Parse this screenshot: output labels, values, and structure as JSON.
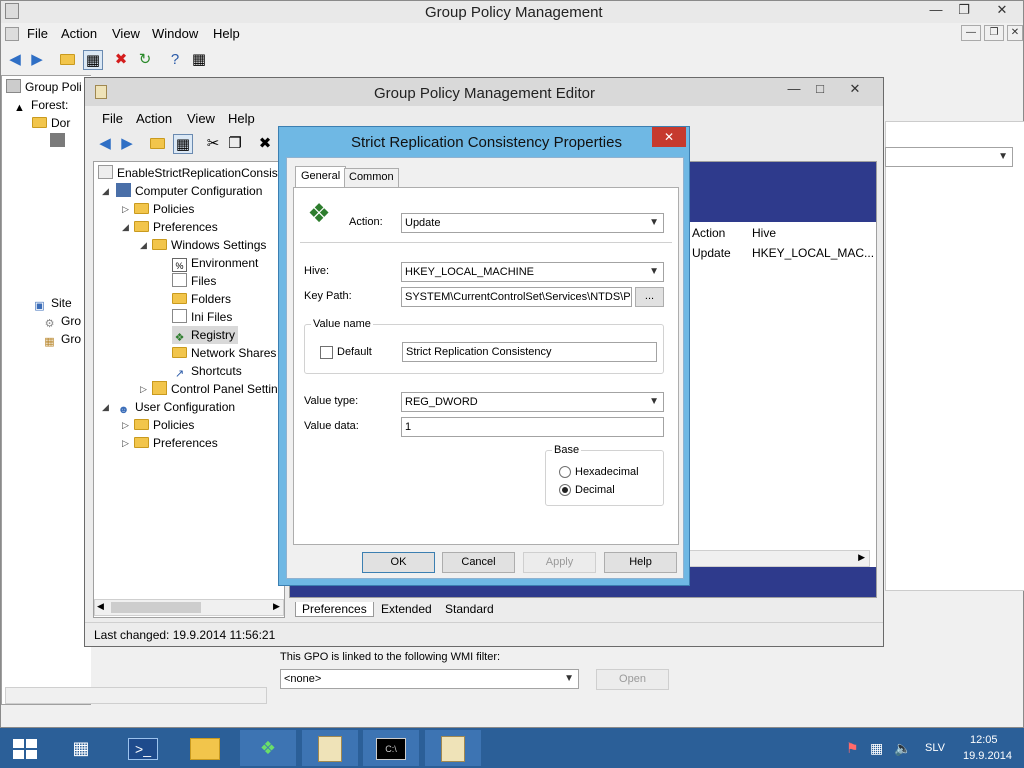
{
  "main_window": {
    "title": "Group Policy Management",
    "menu": [
      "File",
      "Action",
      "View",
      "Window",
      "Help"
    ],
    "tree": [
      "Group Poli",
      "Forest:",
      "Dor",
      "Site",
      "Gro",
      "Gro"
    ],
    "wmi_label": "This GPO is linked to the following WMI filter:",
    "wmi_value": "<none>",
    "open_label": "Open"
  },
  "editor": {
    "title": "Group Policy Management Editor",
    "menu": [
      "File",
      "Action",
      "View",
      "Help"
    ],
    "tree": {
      "root": "EnableStrictReplicationConsist",
      "computer_config": "Computer Configuration",
      "policies": "Policies",
      "preferences": "Preferences",
      "windows_settings": "Windows Settings",
      "environment": "Environment",
      "files": "Files",
      "folders": "Folders",
      "ini_files": "Ini Files",
      "registry": "Registry",
      "network_shares": "Network Shares",
      "shortcuts": "Shortcuts",
      "control_panel": "Control Panel Settin",
      "user_config": "User Configuration",
      "user_policies": "Policies",
      "user_preferences": "Preferences"
    },
    "list": {
      "col_action": "Action",
      "col_hive": "Hive",
      "row_action": "Update",
      "row_hive": "HKEY_LOCAL_MAC..."
    },
    "bottom_tabs": [
      "Preferences",
      "Extended",
      "Standard"
    ],
    "status": "Last changed: 19.9.2014 11:56:21"
  },
  "dialog": {
    "title": "Strict Replication Consistency Properties",
    "tabs": [
      "General",
      "Common"
    ],
    "action_label": "Action:",
    "action_value": "Update",
    "hive_label": "Hive:",
    "hive_value": "HKEY_LOCAL_MACHINE",
    "keypath_label": "Key Path:",
    "keypath_value": "SYSTEM\\CurrentControlSet\\Services\\NTDS\\Pa",
    "browse_label": "...",
    "value_name_group": "Value name",
    "default_label": "Default",
    "value_name": "Strict Replication Consistency",
    "value_type_label": "Value type:",
    "value_type": "REG_DWORD",
    "value_data_label": "Value data:",
    "value_data": "1",
    "base_group": "Base",
    "hex_label": "Hexadecimal",
    "dec_label": "Decimal",
    "ok": "OK",
    "cancel": "Cancel",
    "apply": "Apply",
    "help": "Help"
  },
  "tray": {
    "lang": "SLV",
    "time": "12:05",
    "date": "19.9.2014"
  }
}
